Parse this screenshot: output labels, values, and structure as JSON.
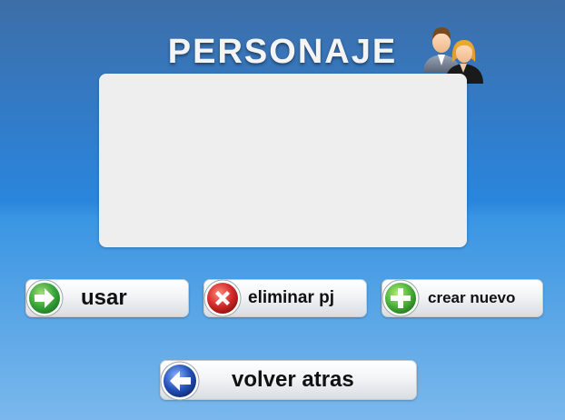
{
  "title": "PERSONAJE",
  "icons": {
    "header": "users-icon",
    "usar": "arrow-right-icon",
    "eliminar": "x-icon",
    "crear": "plus-icon",
    "volver": "arrow-left-icon"
  },
  "buttons": {
    "usar": "usar",
    "eliminar": "eliminar pj",
    "crear": "crear nuevo",
    "volver": "volver atras"
  },
  "colors": {
    "green": "#3aa63a",
    "red": "#d22a2a",
    "blue": "#2553b8",
    "panel": "#eeeeee"
  }
}
